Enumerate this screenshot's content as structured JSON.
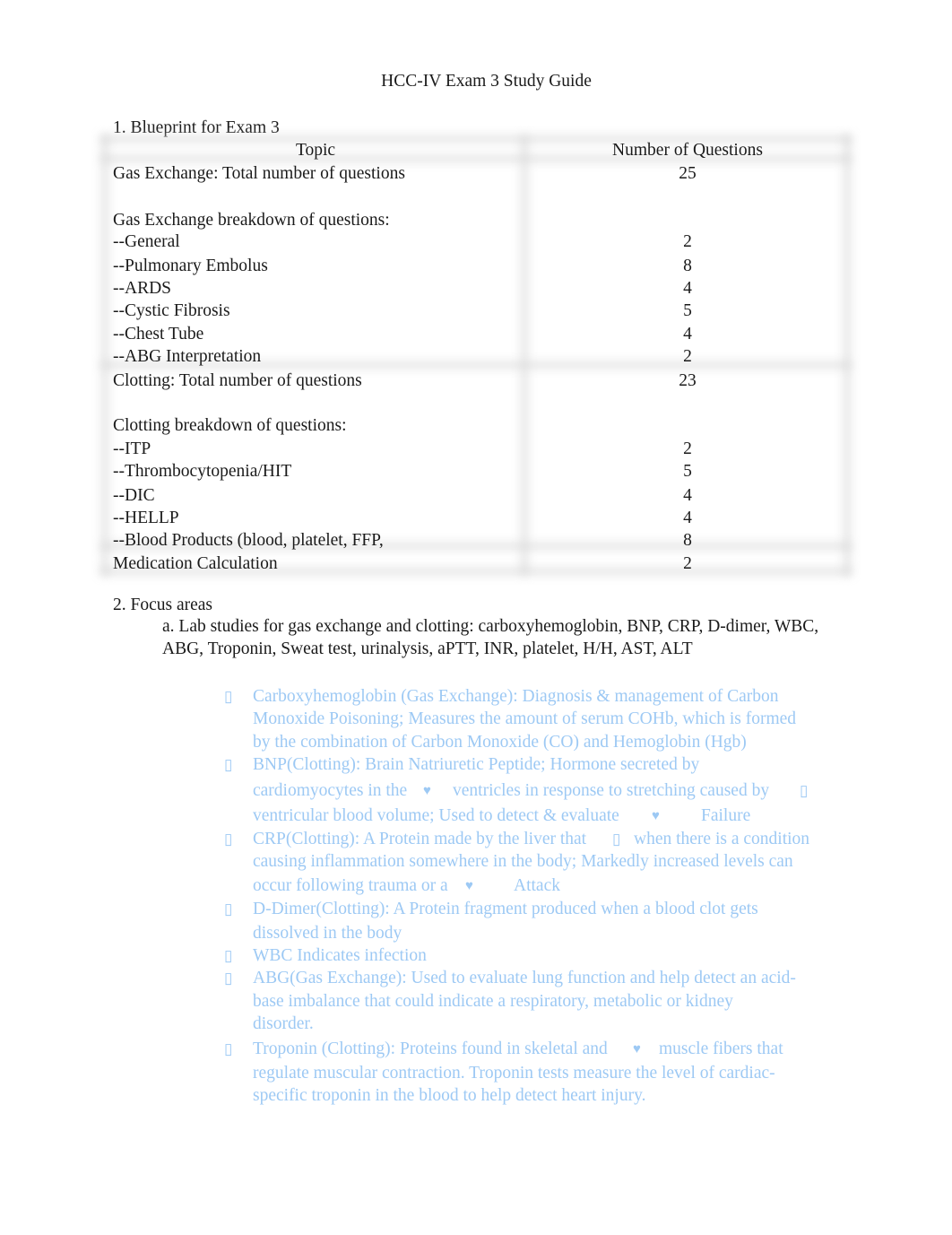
{
  "document": {
    "title": "HCC-IV Exam 3 Study Guide",
    "section1_heading": "1. Blueprint for Exam 3",
    "blueprint_table": {
      "headers": [
        "Topic",
        "Number of Questions"
      ],
      "rows": [
        {
          "topic": "Gas Exchange: Total number of questions",
          "count": "25"
        },
        {
          "topic": "Gas Exchange breakdown of questions:",
          "count": ""
        },
        {
          "topic": "--General",
          "count": "2"
        },
        {
          "topic": "--Pulmonary Embolus",
          "count": "8"
        },
        {
          "topic": "--ARDS",
          "count": "4"
        },
        {
          "topic": "--Cystic Fibrosis",
          "count": "5"
        },
        {
          "topic": "--Chest Tube",
          "count": "4"
        },
        {
          "topic": "--ABG Interpretation",
          "count": "2"
        },
        {
          "topic": "Clotting:  Total number of questions",
          "count": "23"
        },
        {
          "topic": "Clotting breakdown of questions:",
          "count": ""
        },
        {
          "topic": "--ITP",
          "count": "2"
        },
        {
          "topic": "--Thrombocytopenia/HIT",
          "count": "5"
        },
        {
          "topic": "--DIC",
          "count": "4"
        },
        {
          "topic": "--HELLP",
          "count": "4"
        },
        {
          "topic": "--Blood Products (blood, platelet, FFP,",
          "count": "8"
        },
        {
          "topic": "Medication Calculation",
          "count": "2"
        }
      ]
    },
    "section2_heading": "2.  Focus areas",
    "focus_a": "a.  Lab studies for gas exchange and clotting: carboxyhemoglobin, BNP, CRP, D-dimer, WBC, ABG, Troponin, Sweat test, urinalysis, aPTT, INR, platelet, H/H, AST, ALT",
    "bullet_glyph": "▯",
    "heart_glyph": "♥",
    "lab_notes": [
      {
        "lines": [
          "Carboxyhemoglobin (Gas Exchange): Diagnosis & management of Carbon",
          "Monoxide Poisoning; Measures the amount of serum COHb, which is formed",
          "by the combination of Carbon Monoxide (CO) and Hemoglobin (Hgb)"
        ]
      },
      {
        "lines": [
          "BNP(Clotting): Brain Natriuretic Peptide; Hormone secreted by",
          "cardiomyocytes in the",
          "ventricles in response to stretching caused by",
          "ventricular blood volume; Used to detect & evaluate",
          "Failure"
        ]
      },
      {
        "lines": [
          "CRP(Clotting): A Protein made by the liver that",
          "when there is a condition",
          "causing inflammation somewhere in the body; Markedly increased levels can",
          "occur following trauma or a",
          "Attack"
        ]
      },
      {
        "lines": [
          "D-Dimer(Clotting): A Protein fragment produced when a blood clot gets",
          "dissolved in the body"
        ]
      },
      {
        "lines": [
          "WBC Indicates infection"
        ]
      },
      {
        "lines": [
          "ABG(Gas Exchange): Used to evaluate lung function and help detect an acid-",
          "base imbalance that could indicate a respiratory, metabolic or kidney",
          "disorder."
        ]
      },
      {
        "lines": [
          "Troponin (Clotting): Proteins found in skeletal and",
          "muscle fibers that",
          "regulate muscular contraction. Troponin tests measure the level of cardiac-",
          "specific troponin in the blood to help detect heart injury."
        ]
      }
    ],
    "colors": {
      "text": "#1a1a1a",
      "note_blue": "#9dc9f4",
      "table_border": "#d6d6d6"
    }
  }
}
